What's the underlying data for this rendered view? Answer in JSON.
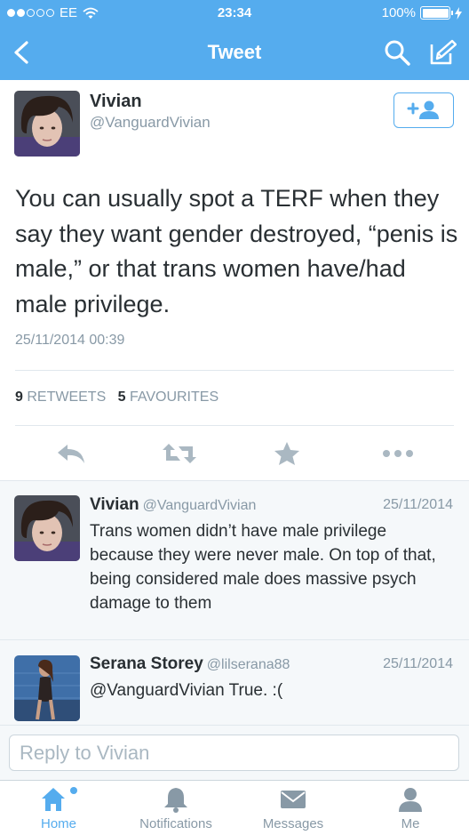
{
  "status_bar": {
    "carrier": "EE",
    "time": "23:34",
    "battery": "100%"
  },
  "nav": {
    "title": "Tweet"
  },
  "tweet": {
    "author_name": "Vivian",
    "author_handle": "@VanguardVivian",
    "text": "You can usually spot a TERF when they say they want gender destroyed, “penis is male,” or that trans women have/had male privilege.",
    "timestamp": "25/11/2014 00:39",
    "retweets_count": "9",
    "retweets_label": "RETWEETS",
    "favourites_count": "5",
    "favourites_label": "FAVOURITES"
  },
  "replies": [
    {
      "name": "Vivian",
      "handle": "@VanguardVivian",
      "date": "25/11/2014",
      "text": "Trans women didn’t have male privilege because they were never male. On top of that, being considered male does massive psych damage to them"
    },
    {
      "name": "Serana Storey",
      "handle": "@lilserana88",
      "date": "25/11/2014",
      "text": "@VanguardVivian True. :("
    }
  ],
  "reply_box": {
    "placeholder": "Reply to Vivian"
  },
  "tabs": [
    {
      "label": "Home",
      "icon": "home-icon",
      "active": true
    },
    {
      "label": "Notifications",
      "icon": "bell-icon",
      "active": false
    },
    {
      "label": "Messages",
      "icon": "envelope-icon",
      "active": false
    },
    {
      "label": "Me",
      "icon": "person-icon",
      "active": false
    }
  ],
  "colors": {
    "brand": "#55acee",
    "text": "#292f33",
    "muted": "#8899a6",
    "action_icons": "#aab8c2"
  }
}
